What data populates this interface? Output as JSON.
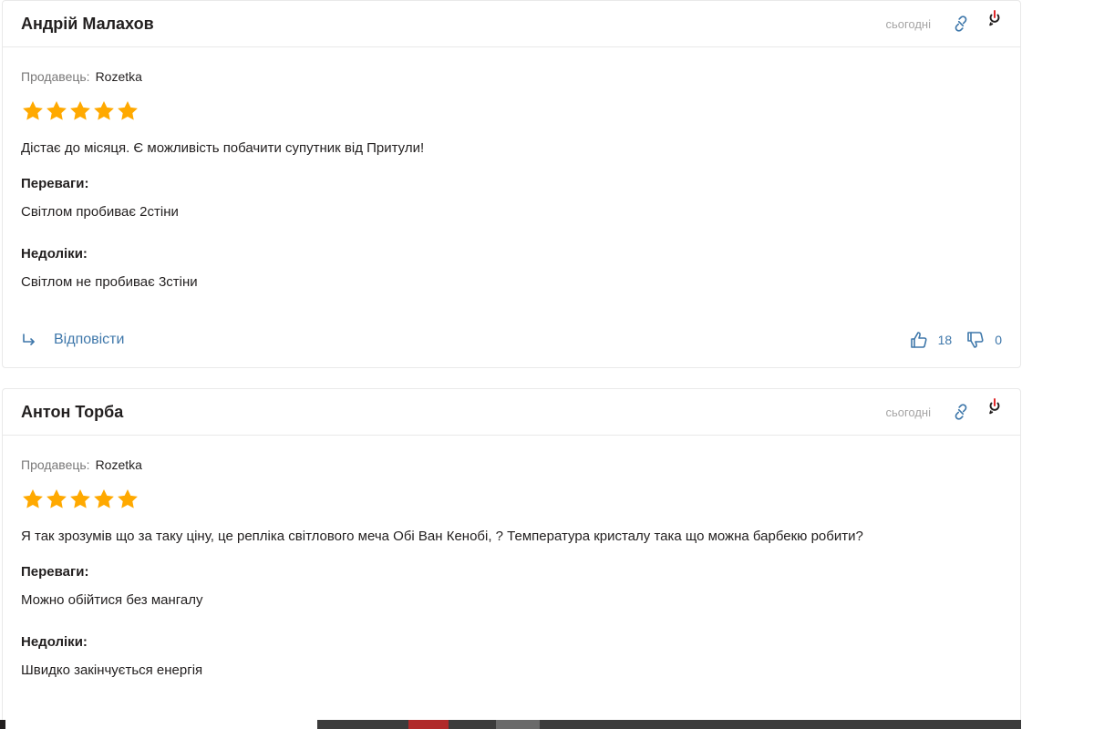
{
  "reviews": [
    {
      "author": "Андрій Малахов",
      "date": "сьогодні",
      "seller_label": "Продавець:",
      "seller_name": "Rozetka",
      "rating": 5,
      "text": "Дістає до місяця. Є можливість побачити супутник від Притули!",
      "pros_title": "Переваги:",
      "pros": "Світлом пробиває 2стіни",
      "cons_title": "Недоліки:",
      "cons": "Світлом не пробиває 3стіни",
      "reply_label": "Відповісти",
      "likes": "18",
      "dislikes": "0"
    },
    {
      "author": "Антон Торба",
      "date": "сьогодні",
      "seller_label": "Продавець:",
      "seller_name": "Rozetka",
      "rating": 5,
      "text": "Я так зрозумів що за таку ціну, це репліка світлового меча Обі Ван Кенобі, ? Температура кристалу така що можна барбекю робити?",
      "pros_title": "Переваги:",
      "pros": "Можно обійтися без мангалу",
      "cons_title": "Недоліки:",
      "cons": "Швидко закінчується енергія"
    }
  ],
  "colors": {
    "star": "#ffa900",
    "link": "#3e77aa",
    "muted": "#a6a5a5",
    "text": "#221f1f"
  },
  "icons": {
    "link": "link-icon",
    "complain": "complain-icon",
    "reply": "reply-arrow-icon",
    "like": "thumbs-up-icon",
    "dislike": "thumbs-down-icon",
    "star": "star-icon"
  }
}
